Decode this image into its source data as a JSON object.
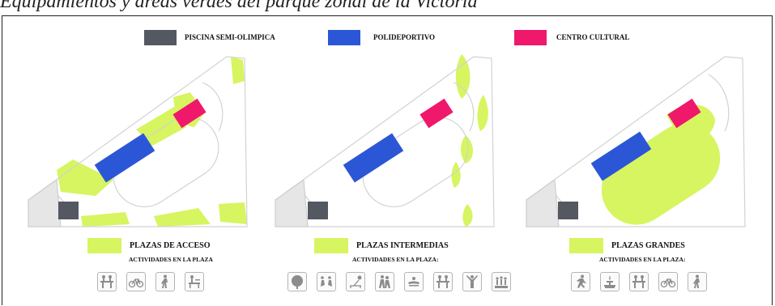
{
  "title": "Equipamientos y áreas verdes del parque zonal de la Victoria",
  "colors": {
    "pool": "#535861",
    "sports": "#2b57d6",
    "culture": "#f0186b",
    "green": "#d6f561",
    "outline": "#d2d2d2"
  },
  "legend": [
    {
      "label": "PISCINA SEMI-OLIMPICA",
      "color": "#535861"
    },
    {
      "label": "POLIDEPORTIVO",
      "color": "#2b57d6"
    },
    {
      "label": "CENTRO CULTURAL",
      "color": "#f0186b"
    }
  ],
  "panels": [
    {
      "caption": "PLAZAS DE ACCESO",
      "subcaption": "ACTIVIDADES EN LA PLAZA",
      "icons": [
        "picnic-icon",
        "bicycle-icon",
        "walking-icon",
        "bench-icon"
      ]
    },
    {
      "caption": "PLAZAS INTERMEDIAS",
      "subcaption": "ACTIVIDADES EN LA PLAZA:",
      "icons": [
        "tree-icon",
        "exercise-icon",
        "lounger-icon",
        "dance-icon",
        "relax-icon",
        "picnic-icon",
        "stretch-icon",
        "group-icon"
      ]
    },
    {
      "caption": "PLAZAS GRANDES",
      "subcaption": "ACTIVIDADES EN LA PLAZA:",
      "icons": [
        "running-icon",
        "fountain-icon",
        "picnic-icon",
        "bicycle-icon",
        "walking-icon"
      ]
    }
  ]
}
